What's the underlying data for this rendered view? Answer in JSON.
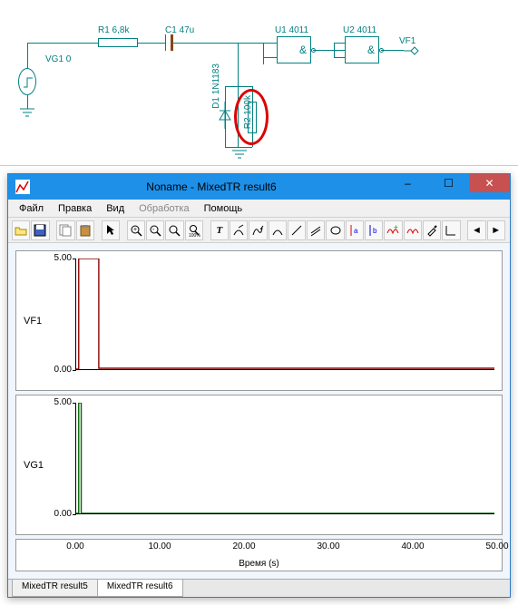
{
  "schematic": {
    "labels": {
      "R1": "R1 6,8k",
      "C1": "C1 47u",
      "U1": "U1 4011",
      "U2": "U2 4011",
      "VF1": "VF1",
      "VG1": "VG1 0",
      "D1": "D1 1N1183",
      "R2": "R2 100k",
      "and1": "&",
      "and2": "&"
    }
  },
  "window": {
    "title": "Noname - MixedTR result6",
    "menu": {
      "file": "Файл",
      "edit": "Правка",
      "view": "Вид",
      "process": "Обработка",
      "help": "Помощь"
    }
  },
  "chart_data": [
    {
      "type": "line",
      "name": "VF1",
      "color": "#8B0000",
      "ylim": [
        0,
        5
      ],
      "yticks": [
        0.0,
        5.0
      ],
      "series": [
        {
          "name": "VF1",
          "x": [
            0,
            0.3,
            0.3,
            2.7,
            2.7,
            50
          ],
          "y": [
            0,
            0,
            5,
            5,
            0.05,
            0.05
          ]
        }
      ]
    },
    {
      "type": "line",
      "name": "VG1",
      "color": "#006400",
      "ylim": [
        0,
        5
      ],
      "yticks": [
        0.0,
        5.0
      ],
      "series": [
        {
          "name": "VG1",
          "x": [
            0,
            0.3,
            0.3,
            0.6,
            0.6,
            50
          ],
          "y": [
            0,
            0,
            5,
            5,
            0,
            0
          ]
        }
      ]
    }
  ],
  "xaxis": {
    "ticks": [
      "0.00",
      "10.00",
      "20.00",
      "30.00",
      "40.00",
      "50.00"
    ],
    "label": "Время (s)"
  },
  "tabs": {
    "t1": "MixedTR result5",
    "t2": "MixedTR result6"
  },
  "yticks": {
    "lo": "0.00",
    "hi": "5.00"
  }
}
